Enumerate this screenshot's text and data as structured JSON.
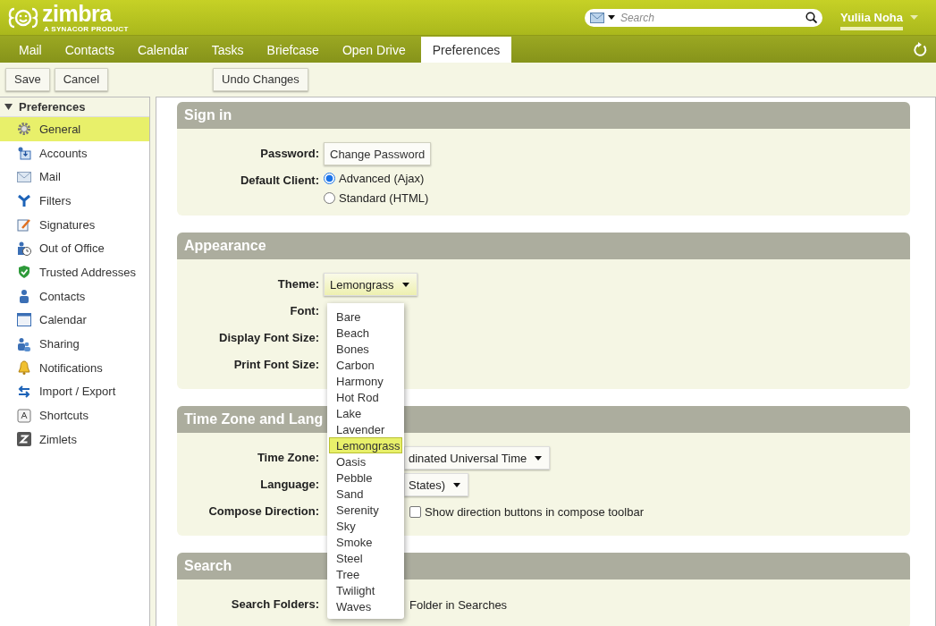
{
  "header": {
    "logo": "zimbra",
    "tagline": "A SYNACOR PRODUCT",
    "search": {
      "placeholder": "Search"
    },
    "user": "Yuliia Noha"
  },
  "tabs": [
    {
      "label": "Mail",
      "selected": false
    },
    {
      "label": "Contacts",
      "selected": false
    },
    {
      "label": "Calendar",
      "selected": false
    },
    {
      "label": "Tasks",
      "selected": false
    },
    {
      "label": "Briefcase",
      "selected": false
    },
    {
      "label": "Open Drive",
      "selected": false
    },
    {
      "label": "Preferences",
      "selected": true
    }
  ],
  "toolbar": {
    "left": [
      "Save",
      "Cancel"
    ],
    "right": [
      "Undo Changes"
    ]
  },
  "sidebar": {
    "title": "Preferences",
    "expanded": true,
    "items": [
      {
        "label": "General",
        "selected": true
      },
      {
        "label": "Accounts",
        "selected": false
      },
      {
        "label": "Mail",
        "selected": false
      },
      {
        "label": "Filters",
        "selected": false
      },
      {
        "label": "Signatures",
        "selected": false
      },
      {
        "label": "Out of Office",
        "selected": false
      },
      {
        "label": "Trusted Addresses",
        "selected": false
      },
      {
        "label": "Contacts",
        "selected": false
      },
      {
        "label": "Calendar",
        "selected": false
      },
      {
        "label": "Sharing",
        "selected": false
      },
      {
        "label": "Notifications",
        "selected": false
      },
      {
        "label": "Import / Export",
        "selected": false
      },
      {
        "label": "Shortcuts",
        "selected": false
      },
      {
        "label": "Zimlets",
        "selected": false
      }
    ]
  },
  "sections": [
    {
      "title": "Sign in",
      "rows": [
        {
          "label": "Password:",
          "kind": "button",
          "value": "Change Password"
        },
        {
          "label": "Default Client:",
          "kind": "radio",
          "options": [
            {
              "label": "Advanced (Ajax)",
              "selected": true
            },
            {
              "label": "Standard (HTML)",
              "selected": false
            }
          ]
        }
      ]
    },
    {
      "title": "Appearance",
      "rows": [
        {
          "label": "Theme:",
          "kind": "select",
          "value": "Lemongrass",
          "open": true
        },
        {
          "label": "Font:",
          "kind": "blank"
        },
        {
          "label": "Display Font Size:",
          "kind": "blank"
        },
        {
          "label": "Print Font Size:",
          "kind": "blank"
        }
      ]
    },
    {
      "title": "Time Zone and Lang",
      "rows": [
        {
          "label": "Time Zone:",
          "kind": "select",
          "value": "dinated Universal Time",
          "open": false
        },
        {
          "label": "Language:",
          "kind": "select",
          "value": "States)",
          "open": false
        },
        {
          "label": "Compose Direction:",
          "kind": "checkbox",
          "checked": false,
          "value": "Show direction buttons in compose toolbar"
        }
      ]
    },
    {
      "title": "Search",
      "rows": [
        {
          "label": "Search Folders:",
          "kind": "text",
          "value": "Folder in Searches"
        }
      ]
    }
  ],
  "theme_menu": {
    "items": [
      {
        "label": "Bare",
        "selected": false
      },
      {
        "label": "Beach",
        "selected": false
      },
      {
        "label": "Bones",
        "selected": false
      },
      {
        "label": "Carbon",
        "selected": false
      },
      {
        "label": "Harmony",
        "selected": false
      },
      {
        "label": "Hot Rod",
        "selected": false
      },
      {
        "label": "Lake",
        "selected": false
      },
      {
        "label": "Lavender",
        "selected": false
      },
      {
        "label": "Lemongrass",
        "selected": true
      },
      {
        "label": "Oasis",
        "selected": false
      },
      {
        "label": "Pebble",
        "selected": false
      },
      {
        "label": "Sand",
        "selected": false
      },
      {
        "label": "Serenity",
        "selected": false
      },
      {
        "label": "Sky",
        "selected": false
      },
      {
        "label": "Smoke",
        "selected": false
      },
      {
        "label": "Steel",
        "selected": false
      },
      {
        "label": "Tree",
        "selected": false
      },
      {
        "label": "Twilight",
        "selected": false
      },
      {
        "label": "Waves",
        "selected": false
      }
    ]
  }
}
